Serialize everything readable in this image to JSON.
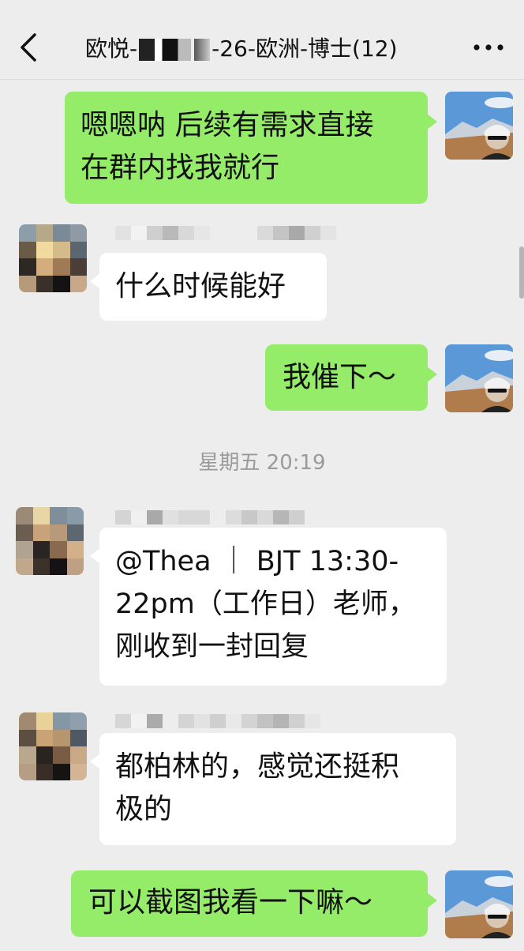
{
  "header": {
    "title_prefix": "欧悦-",
    "title_suffix": "-26-欧洲-博士(12)",
    "back_icon": "chevron-left-icon",
    "more_icon": "more-dots-icon"
  },
  "messages": [
    {
      "side": "me",
      "text_lines": [
        "嗯嗯呐 后续有需求直接",
        "在群内找我就行"
      ]
    },
    {
      "side": "other",
      "text_lines": [
        "什么时候能好"
      ]
    },
    {
      "side": "me",
      "text_lines": [
        "我催下～"
      ]
    },
    {
      "side": "other",
      "text_lines": [
        "@Thea ｜ BJT 13:30-",
        "22pm（工作日）老师，",
        "刚收到一封回复"
      ]
    },
    {
      "side": "other",
      "text_lines": [
        "都柏林的，感觉还挺积",
        "极的"
      ]
    },
    {
      "side": "me",
      "text_lines": [
        "可以截图我看一下嘛～"
      ]
    }
  ],
  "timestamp": "星期五 20:19",
  "colors": {
    "background": "#ededed",
    "my_bubble": "#95ec69",
    "other_bubble": "#ffffff"
  }
}
